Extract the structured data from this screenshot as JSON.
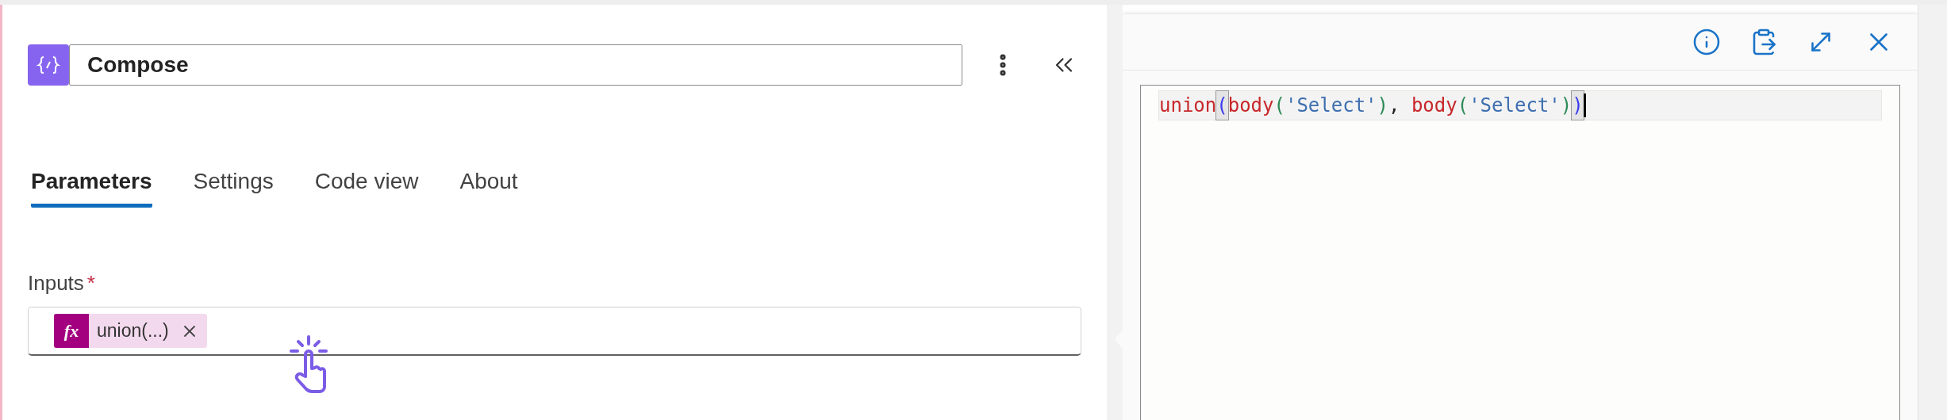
{
  "action": {
    "title": "Compose"
  },
  "tabs": [
    {
      "label": "Parameters",
      "selected": true
    },
    {
      "label": "Settings",
      "selected": false
    },
    {
      "label": "Code view",
      "selected": false
    },
    {
      "label": "About",
      "selected": false
    }
  ],
  "inputs": {
    "label": "Inputs",
    "required_mark": "*",
    "token": {
      "icon": "fx",
      "label": "union(...)"
    }
  },
  "editor": {
    "code": [
      {
        "text": "union",
        "kind": "fn",
        "matched": false
      },
      {
        "text": "(",
        "kind": "bracket1",
        "matched": true
      },
      {
        "text": "body",
        "kind": "fn",
        "matched": false
      },
      {
        "text": "(",
        "kind": "bracket2",
        "matched": false
      },
      {
        "text": "'Select'",
        "kind": "str",
        "matched": false
      },
      {
        "text": ")",
        "kind": "bracket2",
        "matched": false
      },
      {
        "text": ", ",
        "kind": "punct",
        "matched": false
      },
      {
        "text": "body",
        "kind": "fn",
        "matched": false
      },
      {
        "text": "(",
        "kind": "bracket2",
        "matched": false
      },
      {
        "text": "'Select'",
        "kind": "str",
        "matched": false
      },
      {
        "text": ")",
        "kind": "bracket2",
        "matched": false
      },
      {
        "text": ")",
        "kind": "bracket1",
        "matched": true
      }
    ]
  }
}
